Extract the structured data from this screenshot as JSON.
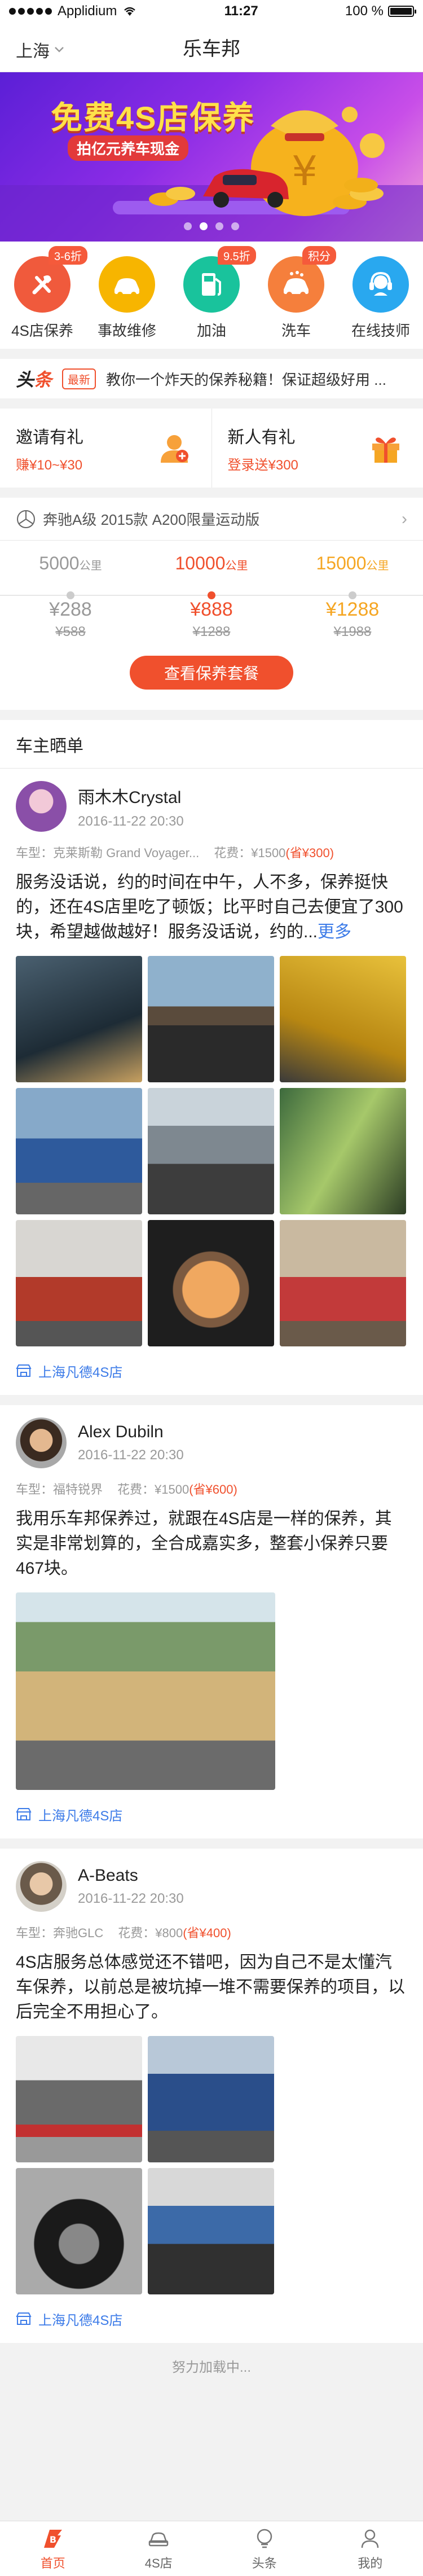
{
  "status_bar": {
    "carrier": "Applidium",
    "time": "11:27",
    "battery": "100 %"
  },
  "nav": {
    "city": "上海",
    "title": "乐车邦"
  },
  "banner": {
    "headline": "免费4S店保养",
    "subline": "拍亿元养车现金",
    "pages": 4,
    "active_page": 1
  },
  "services": [
    {
      "label": "4S店保养",
      "badge": "3-6折",
      "color": "#f05a3c",
      "icon": "wrench-icon"
    },
    {
      "label": "事故维修",
      "badge": "",
      "color": "#f7b500",
      "icon": "car-repair-icon"
    },
    {
      "label": "加油",
      "badge": "9.5折",
      "color": "#19c39c",
      "icon": "fuel-icon"
    },
    {
      "label": "洗车",
      "badge": "积分",
      "color": "#f57f3c",
      "icon": "car-wash-icon"
    },
    {
      "label": "在线技师",
      "badge": "",
      "color": "#29a8ef",
      "icon": "headset-icon"
    }
  ],
  "toutiao": {
    "logo_a": "头",
    "logo_b": "条",
    "tag": "最新",
    "text": "教你一个炸天的保养秘籍！保证超级好用 ..."
  },
  "invite": {
    "left": {
      "title": "邀请有礼",
      "sub": "赚¥10~¥30"
    },
    "right": {
      "title": "新人有礼",
      "sub": "登录送¥300"
    }
  },
  "car_plan": {
    "car_name": "奔驰A级 2015款 A200限量运动版",
    "unit": "公里",
    "plans": [
      {
        "km": "5000",
        "price": "¥288",
        "old": "¥588"
      },
      {
        "km": "10000",
        "price": "¥888",
        "old": "¥1288"
      },
      {
        "km": "15000",
        "price": "¥1288",
        "old": "¥1988"
      }
    ],
    "cta": "查看保养套餐"
  },
  "feed": {
    "title": "车主晒单",
    "posts": [
      {
        "name": "雨木木Crystal",
        "date": "2016-11-22  20:30",
        "car": "车型：克莱斯勒 Grand Voyager...",
        "cost": "花费：¥1500",
        "save": "(省¥300)",
        "content": "服务没话说，约的时间在中午，人不多，保养挺快的，还在4S店里吃了顿饭；比平时自己去便宜了300块，希望越做越好！服务没话说，约的...",
        "more": "更多",
        "shop": "上海凡德4S店"
      },
      {
        "name": "Alex Dubiln",
        "date": "2016-11-22  20:30",
        "car": "车型：福特锐界",
        "cost": "花费：¥1500",
        "save": "(省¥600)",
        "content": "我用乐车邦保养过，就跟在4S店是一样的保养，其实是非常划算的，全合成嘉实多，整套小保养只要467块。",
        "shop": "上海凡德4S店"
      },
      {
        "name": "A-Beats",
        "date": "2016-11-22  20:30",
        "car": "车型：奔驰GLC",
        "cost": "花费：¥800",
        "save": "(省¥400)",
        "content": "4S店服务总体感觉还不错吧，因为自己不是太懂汽车保养，以前总是被坑掉一堆不需要保养的项目，以后完全不用担心了。",
        "shop": "上海凡德4S店"
      }
    ]
  },
  "loading": "努力加载中...",
  "tabs": [
    {
      "label": "首页",
      "icon": "home-logo-icon"
    },
    {
      "label": "4S店",
      "icon": "car-icon"
    },
    {
      "label": "头条",
      "icon": "bulb-icon"
    },
    {
      "label": "我的",
      "icon": "person-icon"
    }
  ],
  "colors": {
    "accent": "#f0502d",
    "link": "#3c7be8",
    "gold": "#f5a623"
  }
}
